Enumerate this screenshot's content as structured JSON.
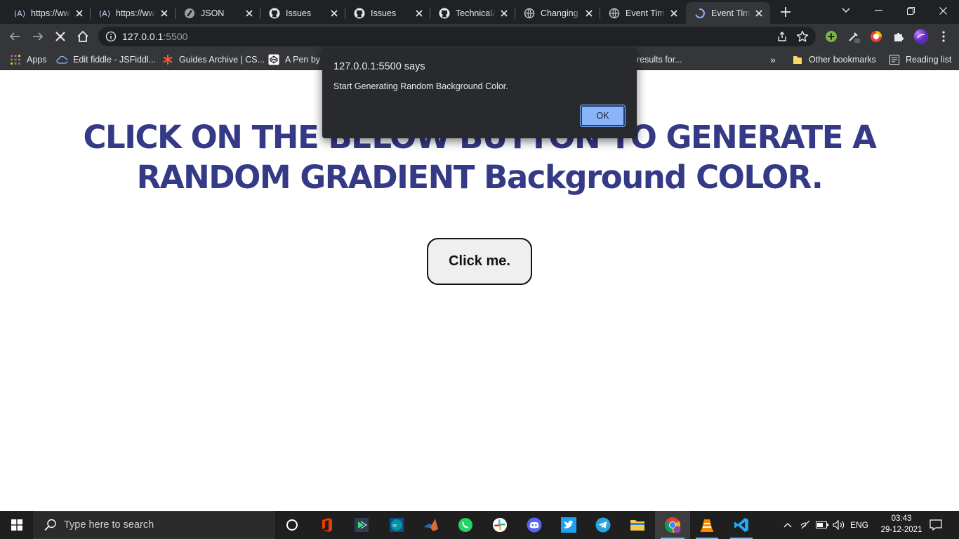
{
  "browser": {
    "tabs": [
      {
        "title": "https://www.cssmatic.com",
        "icon": "cssmatic-icon"
      },
      {
        "title": "https://www.cssmatic.com",
        "icon": "cssmatic-icon"
      },
      {
        "title": "JSON",
        "icon": "json-icon"
      },
      {
        "title": "Issues",
        "icon": "github-icon"
      },
      {
        "title": "Issues",
        "icon": "github-icon"
      },
      {
        "title": "TechnicalA",
        "icon": "github-icon"
      },
      {
        "title": "Changing",
        "icon": "globe-icon"
      },
      {
        "title": "Event Time",
        "icon": "globe-icon"
      },
      {
        "title": "Event Time",
        "icon": "loading-spinner-icon"
      }
    ],
    "address": {
      "host": "127.0.0.1",
      "port": ":5500"
    },
    "bookmarks": {
      "apps": "Apps",
      "items": [
        "Edit fiddle - JSFiddl...",
        "Guides Archive | CS...",
        "A Pen by A"
      ],
      "partial": "results for...",
      "more": "»",
      "other": "Other bookmarks",
      "reading": "Reading list"
    }
  },
  "page": {
    "heading": "CLICK ON THE BELOW BUTTON TO GENERATE A RANDOM GRADIENT Background COLOR.",
    "button_label": "Click me."
  },
  "dialog": {
    "title": "127.0.0.1:5500 says",
    "message": "Start Generating Random Background Color.",
    "ok_label": "OK"
  },
  "taskbar": {
    "search_placeholder": "Type here to search",
    "language": "ENG",
    "time": "03:43",
    "date": "29-12-2021"
  },
  "colors": {
    "heading": "#343a86",
    "dialog_bg": "#292a2d",
    "ok_button": "#8ab4f8",
    "chrome_dark": "#202124",
    "toolbar": "#35363a"
  }
}
